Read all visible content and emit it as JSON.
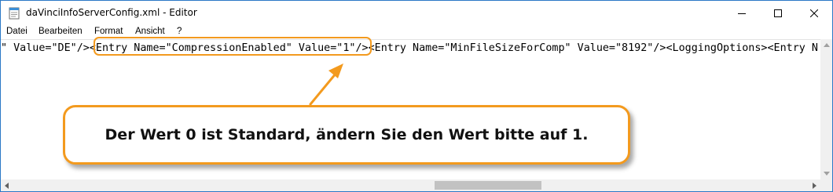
{
  "window": {
    "title": "daVinciInfoServerConfig.xml - Editor",
    "controls": [
      "minimize-icon",
      "maximize-icon",
      "close-icon"
    ]
  },
  "menu": [
    "Datei",
    "Bearbeiten",
    "Format",
    "Ansicht",
    "?"
  ],
  "editor": {
    "line": "\" Value=\"DE\"/><Entry Name=\"CompressionEnabled\" Value=\"1\"/><Entry Name=\"MinFileSizeForComp\" Value=\"8192\"/><LoggingOptions><Entry N"
  },
  "annotation": {
    "callout_text": "Der Wert 0 ist Standard, ändern Sie den Wert bitte auf 1.",
    "accent_color": "#f39a1e"
  }
}
